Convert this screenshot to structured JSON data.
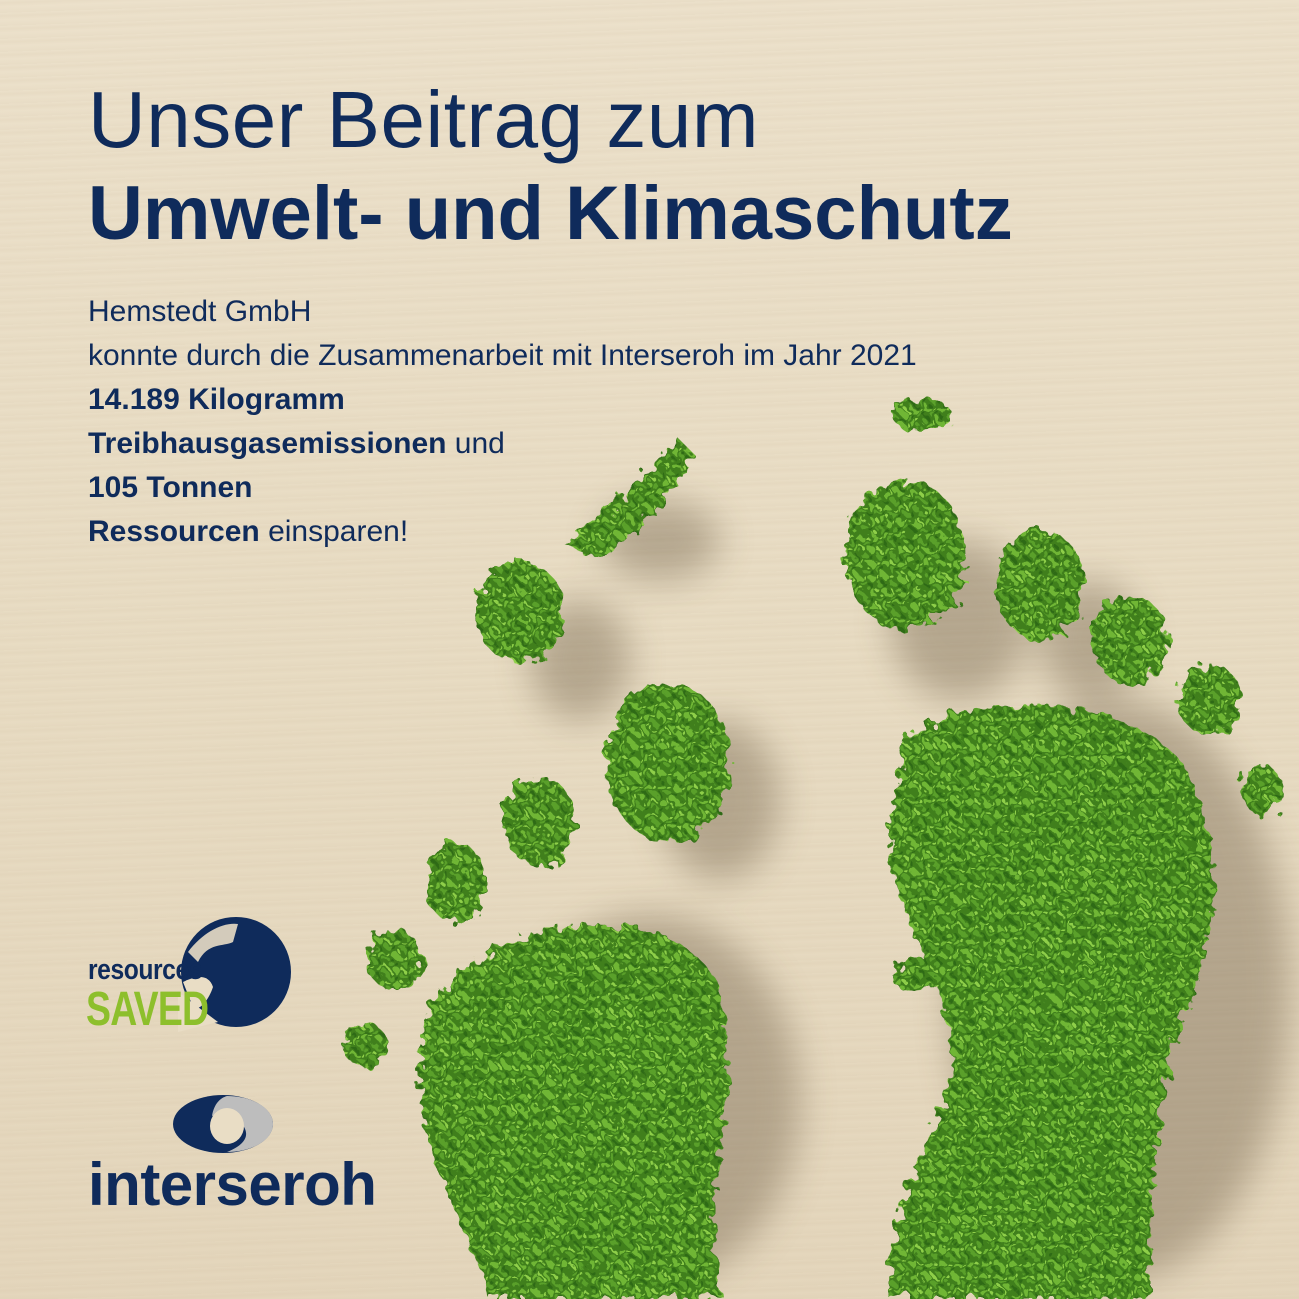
{
  "headline": {
    "line1": "Unser Beitrag zum",
    "line2": "Umwelt- und Klimaschutz"
  },
  "body": {
    "company": "Hemstedt GmbH",
    "intro": "konnte durch die Zusammenarbeit mit Interseroh im Jahr 2021",
    "amount1": "14.189 Kilogramm",
    "item1": "Treibhausgasemissionen",
    "connector": " und",
    "amount2": "105 Tonnen",
    "item2": "Ressourcen",
    "closing": " einsparen!"
  },
  "logos": {
    "resources_saved": {
      "word1": "resources",
      "word2": "SAVED"
    },
    "interseroh": {
      "word": "interseroh"
    }
  },
  "colors": {
    "navy": "#0f2b5b",
    "green": "#8dbf2c",
    "background": "#e9ddc5"
  },
  "image": {
    "icon": "tree-footprints-illustration"
  }
}
